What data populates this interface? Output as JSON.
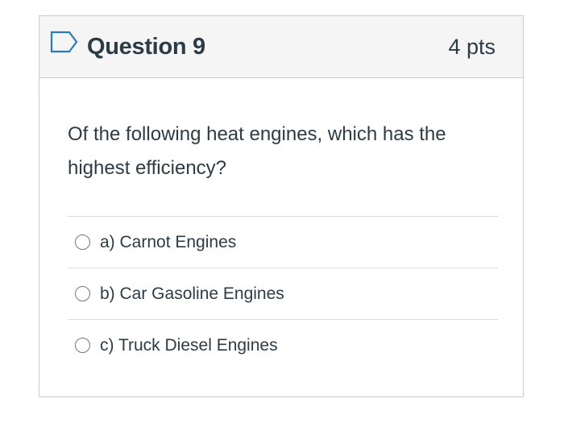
{
  "question": {
    "title": "Question 9",
    "points": "4 pts",
    "flag_icon": "bookmark-flag-icon",
    "text": "Of the following heat engines, which has the highest efficiency?",
    "answers": [
      {
        "label": "a) Carnot Engines"
      },
      {
        "label": "b) Car Gasoline Engines"
      },
      {
        "label": "c) Truck Diesel Engines"
      }
    ]
  },
  "colors": {
    "header_background": "#f5f5f5",
    "border": "#c7cdd1",
    "flag_accent": "#2b7abc",
    "text": "#2d3b45"
  }
}
